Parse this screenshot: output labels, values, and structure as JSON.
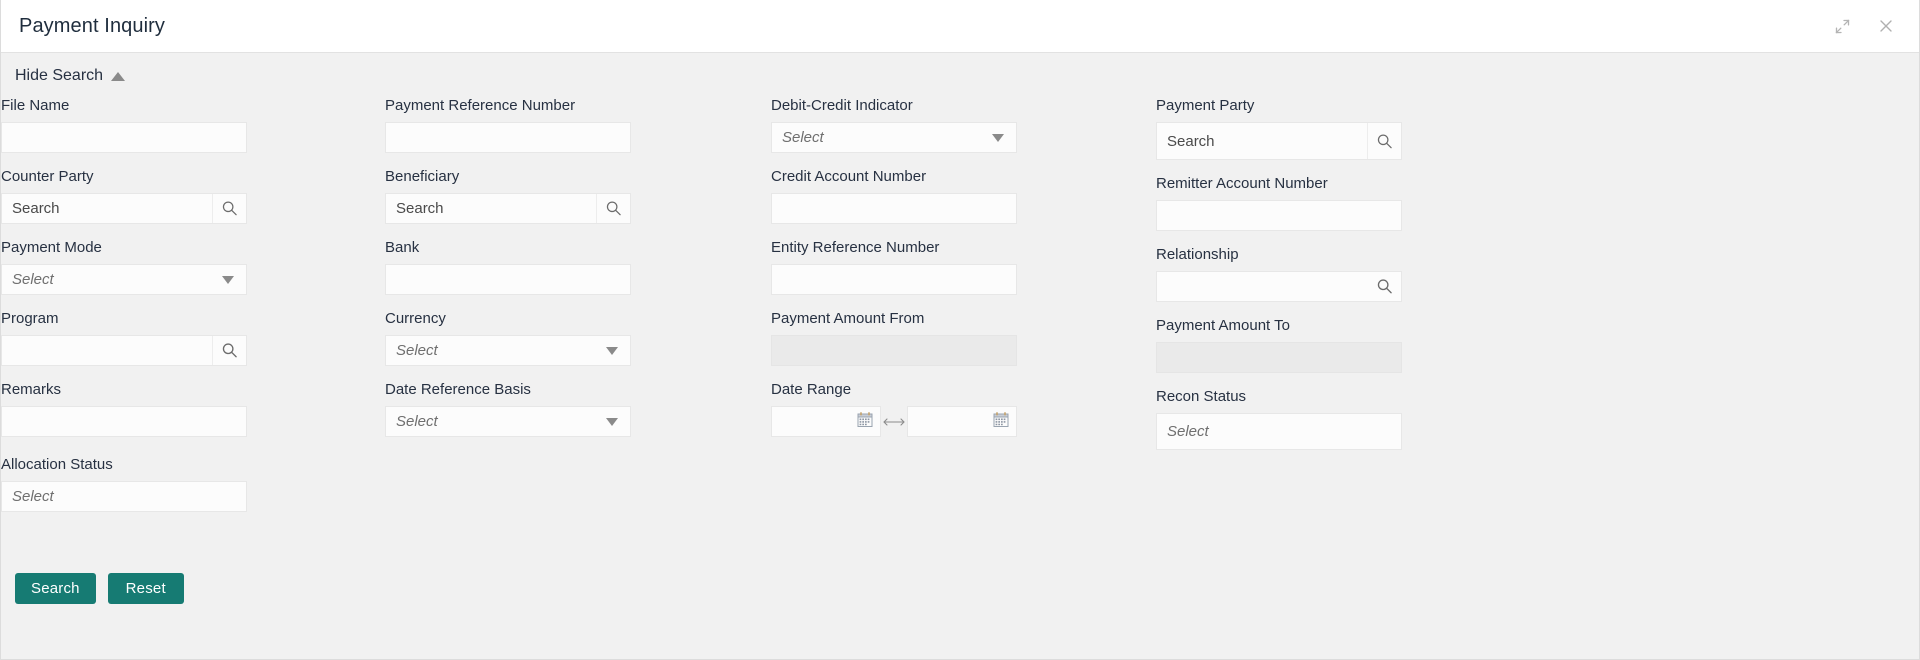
{
  "window": {
    "title": "Payment Inquiry",
    "restore_icon": "restore-down-icon",
    "close_icon": "close-icon"
  },
  "toggle": {
    "label": "Hide Search",
    "caret_icon": "caret-up-icon"
  },
  "theme": {
    "accent": "#167b73",
    "page_bg": "#f1f1f1",
    "field_bg": "#fcfcfc",
    "field_border": "#e7e7e7",
    "disabled_bg": "#eaeaea",
    "label_color": "#273142"
  },
  "placeholders": {
    "search": "Search",
    "select": "Select",
    "empty": ""
  },
  "columns": [
    {
      "fields": [
        {
          "label": "File Name",
          "type": "text",
          "value": "",
          "placeholder": ""
        },
        {
          "label": "Counter Party",
          "type": "lov",
          "value": "",
          "placeholder": "Search"
        },
        {
          "label": "Payment Mode",
          "type": "select",
          "value": "",
          "placeholder": "Select"
        },
        {
          "label": "Program",
          "type": "lov",
          "value": "",
          "placeholder": ""
        },
        {
          "label": "Remarks",
          "type": "text",
          "value": "",
          "placeholder": ""
        },
        {
          "label": "Allocation Status",
          "type": "multiselect",
          "value": "",
          "placeholder": "Select"
        }
      ]
    },
    {
      "fields": [
        {
          "label": "Payment Reference Number",
          "type": "text",
          "value": "",
          "placeholder": ""
        },
        {
          "label": "Beneficiary",
          "type": "lov",
          "value": "",
          "placeholder": "Search"
        },
        {
          "label": "Bank",
          "type": "text",
          "value": "",
          "placeholder": ""
        },
        {
          "label": "Currency",
          "type": "select",
          "value": "",
          "placeholder": "Select"
        },
        {
          "label": "Date Reference Basis",
          "type": "select",
          "value": "",
          "placeholder": "Select"
        }
      ]
    },
    {
      "fields": [
        {
          "label": "Debit-Credit Indicator",
          "type": "select",
          "value": "",
          "placeholder": "Select"
        },
        {
          "label": "Credit Account Number",
          "type": "text",
          "value": "",
          "placeholder": ""
        },
        {
          "label": "Entity Reference Number",
          "type": "text",
          "value": "",
          "placeholder": ""
        },
        {
          "label": "Payment Amount From",
          "type": "disabled",
          "value": "",
          "placeholder": ""
        },
        {
          "label": "Date Range",
          "type": "daterange",
          "from_value": "",
          "to_value": "",
          "from_icon": "calendar-icon",
          "to_icon": "calendar-icon",
          "separator_icon": "arrows-horizontal-icon"
        }
      ]
    },
    {
      "fields": [
        {
          "label": "Payment Party",
          "type": "lov",
          "value": "",
          "placeholder": "Search"
        },
        {
          "label": "Remitter Account Number",
          "type": "text",
          "value": "",
          "placeholder": ""
        },
        {
          "label": "Relationship",
          "type": "lov",
          "value": "",
          "placeholder": ""
        },
        {
          "label": "Payment Amount To",
          "type": "disabled",
          "value": "",
          "placeholder": ""
        },
        {
          "label": "Recon Status",
          "type": "multiselect",
          "value": "",
          "placeholder": "Select"
        }
      ]
    }
  ],
  "buttons": {
    "search": "Search",
    "reset": "Reset"
  },
  "icons": {
    "magnifier": "search-icon",
    "calendar": "calendar-icon"
  }
}
